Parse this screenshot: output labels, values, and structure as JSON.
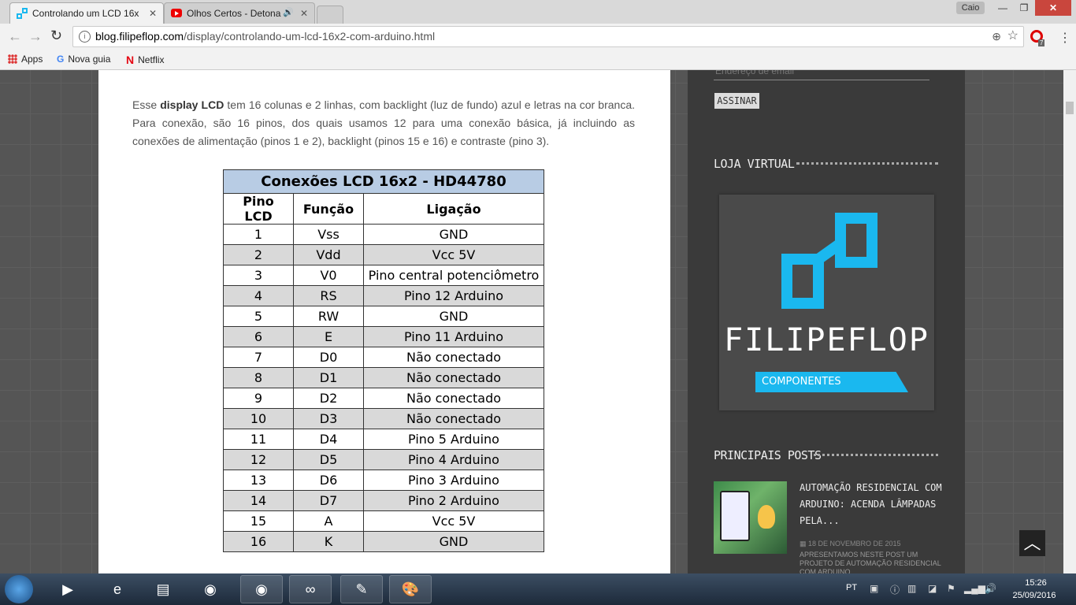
{
  "browser": {
    "tabs": [
      {
        "title": "Controlando um LCD 16x"
      },
      {
        "title": "Olhos Certos - Detona"
      }
    ],
    "user": "Caio",
    "window_controls": {
      "minimize": "—",
      "maximize": "❐",
      "close": "✕"
    },
    "url_host": "blog.filipeflop.com",
    "url_path": "/display/controlando-um-lcd-16x2-com-arduino.html",
    "opera_badge": "7",
    "bookmarks": [
      {
        "label": "Apps"
      },
      {
        "label": "Nova guia"
      },
      {
        "label": "Netflix"
      }
    ]
  },
  "article": {
    "intro_before": "Esse ",
    "intro_bold": "display LCD",
    "intro_after": " tem 16 colunas e 2 linhas, com backlight (luz de fundo) azul e letras na cor branca. Para conexão, são 16 pinos, dos quais usamos 12 para uma conexão básica, já incluindo as conexões de alimentação (pinos 1 e 2), backlight (pinos 15 e 16) e contraste (pino 3).",
    "table": {
      "caption": "Conexões LCD 16x2 - HD44780",
      "headers": [
        "Pino LCD",
        "Função",
        "Ligação"
      ],
      "rows": [
        [
          "1",
          "Vss",
          "GND"
        ],
        [
          "2",
          "Vdd",
          "Vcc 5V"
        ],
        [
          "3",
          "V0",
          "Pino central potenciômetro"
        ],
        [
          "4",
          "RS",
          "Pino 12 Arduino"
        ],
        [
          "5",
          "RW",
          "GND"
        ],
        [
          "6",
          "E",
          "Pino 11 Arduino"
        ],
        [
          "7",
          "D0",
          "Não conectado"
        ],
        [
          "8",
          "D1",
          "Não conectado"
        ],
        [
          "9",
          "D2",
          "Não conectado"
        ],
        [
          "10",
          "D3",
          "Não conectado"
        ],
        [
          "11",
          "D4",
          "Pino 5 Arduino"
        ],
        [
          "12",
          "D5",
          "Pino 4 Arduino"
        ],
        [
          "13",
          "D6",
          "Pino 3 Arduino"
        ],
        [
          "14",
          "D7",
          "Pino 2 Arduino"
        ],
        [
          "15",
          "A",
          "Vcc 5V"
        ],
        [
          "16",
          "K",
          "GND"
        ]
      ]
    }
  },
  "sidebar": {
    "email_placeholder": "Endereço de email",
    "subscribe_label": "ASSINAR",
    "loja_title": "LOJA VIRTUAL",
    "logo_word": "FILIPEFLOP",
    "logo_tagline": "COMPONENTES ELETRÔNICOS",
    "posts_title": "PRINCIPAIS POSTS",
    "post": {
      "title": "AUTOMAÇÃO RESIDENCIAL COM ARDUINO: ACENDA LÂMPADAS PELA...",
      "date": "18 DE NOVEMBRO DE 2015",
      "excerpt": "APRESENTAMOS NESTE POST UM PROJETO DE AUTOMAÇÃO RESIDENCIAL COM ARDUINO,"
    },
    "scroll_top_icon": "chevron-up-icon"
  },
  "taskbar": {
    "lang": "PT",
    "time": "15:26",
    "date": "25/09/2016"
  },
  "colors": {
    "accent_blue": "#1ab8ef",
    "table_caption_bg": "#b8cce4",
    "table_alt_row": "#d9d9d9"
  }
}
